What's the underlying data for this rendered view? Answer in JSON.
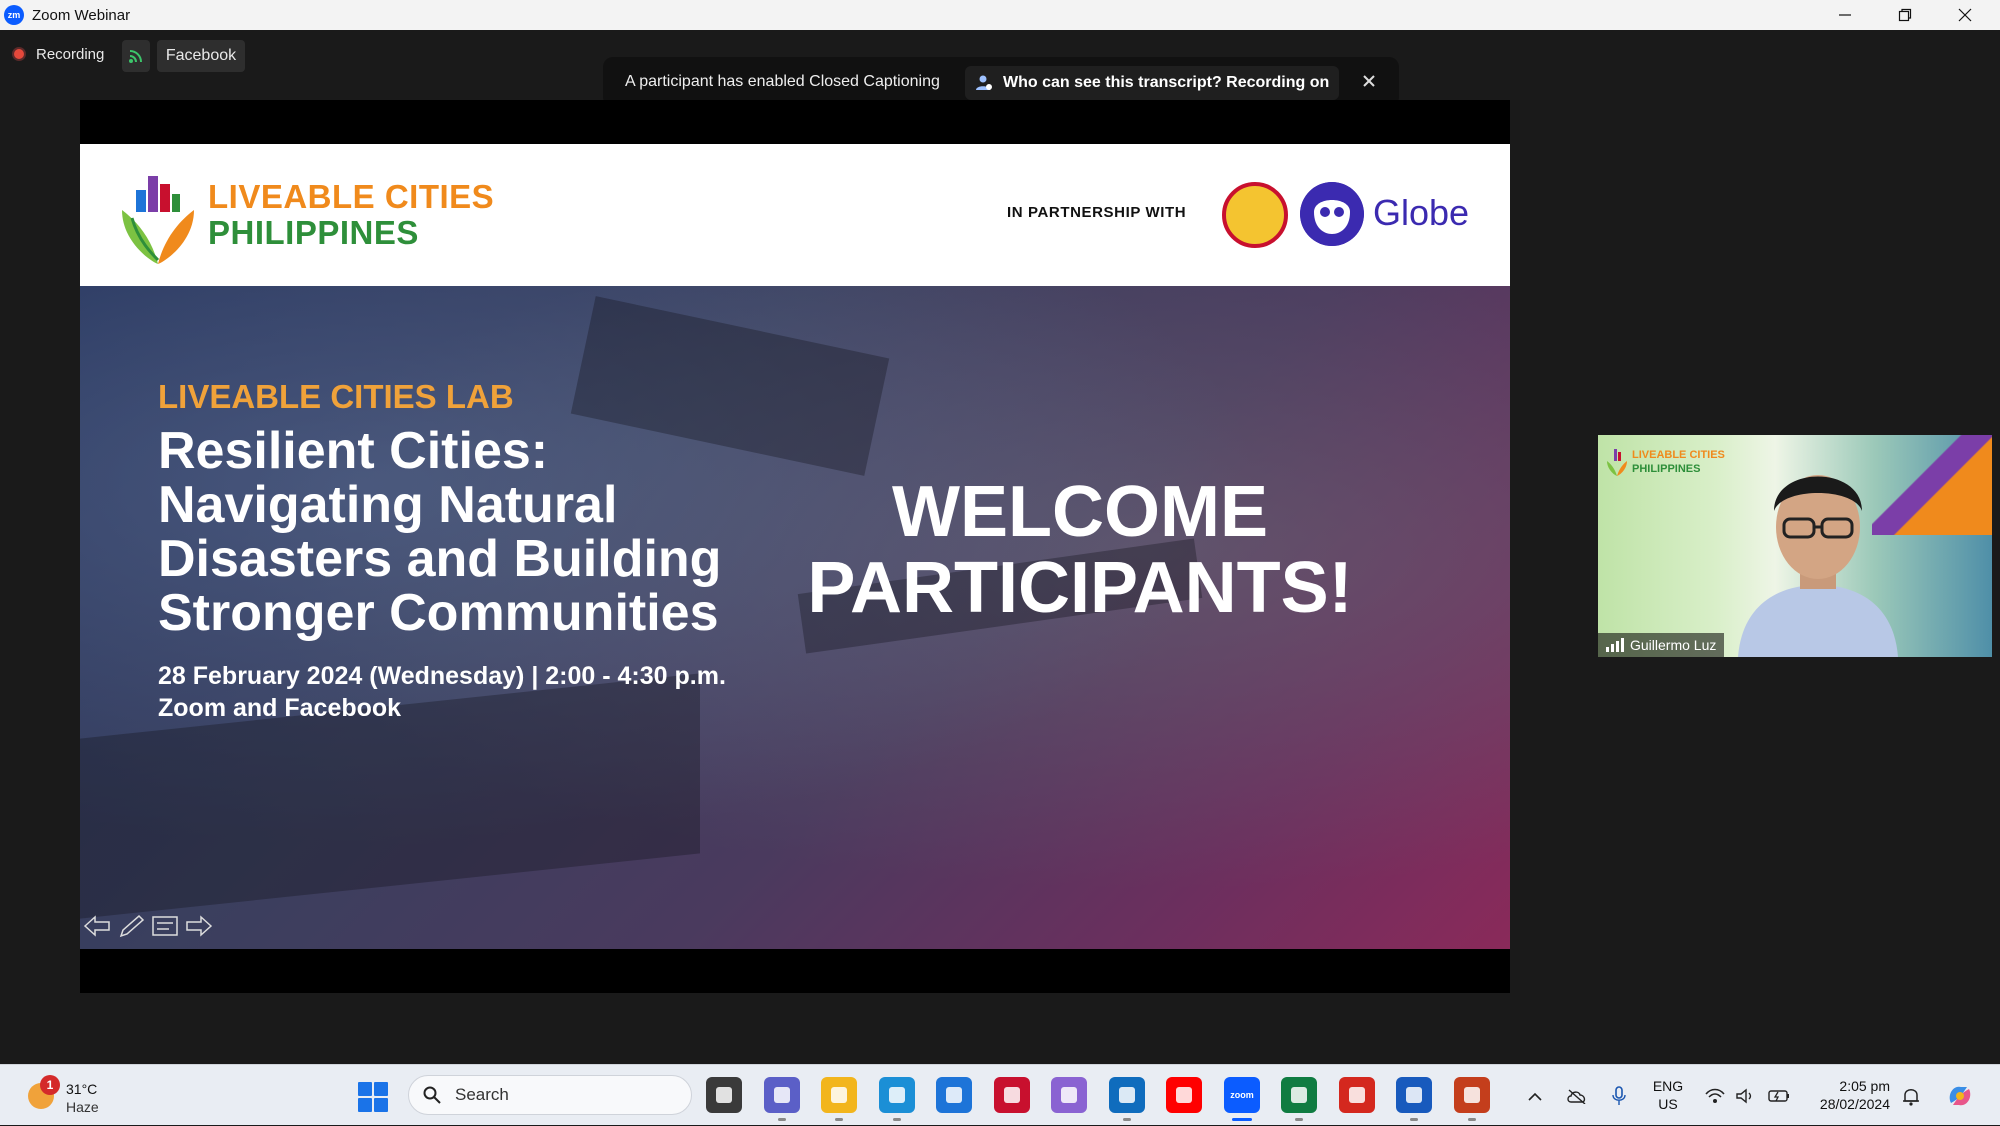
{
  "window": {
    "app_icon": "zoom-icon",
    "title": "Zoom Webinar",
    "minimize": "—",
    "restore": "❐",
    "close": "✕"
  },
  "meeting_bar": {
    "recording_label": "Recording",
    "livestream_icon": "livestream-icon",
    "facebook_label": "Facebook"
  },
  "cc_banner": {
    "message": "A participant has enabled Closed Captioning",
    "transcript_button": "Who can see this transcript? Recording on",
    "close": "✕"
  },
  "slide": {
    "brand_line1": "LIVEABLE CITIES",
    "brand_line2": "PHILIPPINES",
    "partnership_label": "IN PARTNERSHIP WITH",
    "partner_name": "Globe",
    "series": "LIVEABLE CITIES LAB",
    "headline_lines": [
      "Resilient Cities:",
      "Navigating Natural",
      "Disasters and Building",
      "Stronger Communities"
    ],
    "date_line": "28 February 2024 (Wednesday) | 2:00 - 4:30 p.m.",
    "venue_line": "Zoom and Facebook",
    "welcome_lines": [
      "WELCOME",
      "PARTICIPANTS!"
    ]
  },
  "slide_controls": [
    "arrow-left-icon",
    "pen-icon",
    "menu-icon",
    "arrow-right-icon"
  ],
  "video_tile": {
    "logo_line1": "LIVEABLE CITIES",
    "logo_line2": "PHILIPPINES",
    "participant_name": "Guillermo Luz"
  },
  "taskbar": {
    "weather_badge": "1",
    "temperature": "31°C",
    "condition": "Haze",
    "search_label": "Search",
    "apps": [
      {
        "name": "task-view",
        "icon": "task-view-icon",
        "color": "#3a3a3a"
      },
      {
        "name": "teams",
        "icon": "teams-icon",
        "color": "#5b5fc7"
      },
      {
        "name": "file-explorer",
        "icon": "folder-icon",
        "color": "#f2b51c"
      },
      {
        "name": "edge",
        "icon": "edge-icon",
        "color": "#1b8fd6"
      },
      {
        "name": "store",
        "icon": "store-icon",
        "color": "#1d74d8"
      },
      {
        "name": "mcafee",
        "icon": "shield-icon",
        "color": "#c8102e"
      },
      {
        "name": "copilot",
        "icon": "copilot-icon",
        "color": "#8a63d2"
      },
      {
        "name": "outlook",
        "icon": "outlook-icon",
        "color": "#0f6cbd"
      },
      {
        "name": "youtube",
        "icon": "youtube-icon",
        "color": "#ff0000"
      },
      {
        "name": "zoom",
        "icon": "zoom-icon",
        "color": "#0b5cff",
        "label": "zoom"
      },
      {
        "name": "excel",
        "icon": "excel-icon",
        "color": "#107c41"
      },
      {
        "name": "acrobat",
        "icon": "acrobat-icon",
        "color": "#d4281e"
      },
      {
        "name": "word",
        "icon": "word-icon",
        "color": "#185abd"
      },
      {
        "name": "powerpoint",
        "icon": "powerpoint-icon",
        "color": "#c43e1c"
      }
    ],
    "lang_line1": "ENG",
    "lang_line2": "US",
    "time": "2:05 pm",
    "date": "28/02/2024"
  },
  "colors": {
    "brand_orange": "#f08a1c",
    "brand_green": "#2e8f3a",
    "globe_purple": "#3b2ab0",
    "recording_red": "#e5483b",
    "zoom_blue": "#0b5cff"
  }
}
